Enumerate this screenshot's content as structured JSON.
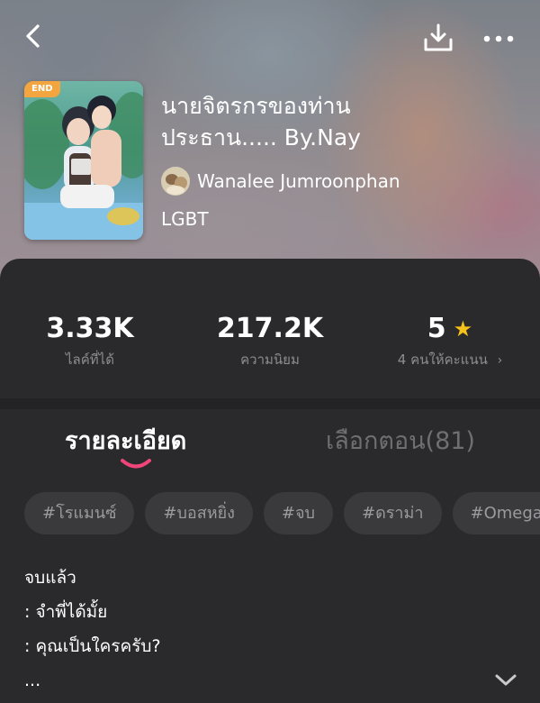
{
  "header": {
    "back_icon": "chevron-left-icon",
    "download_icon": "download-icon",
    "more_icon": "more-horizontal-icon"
  },
  "book": {
    "badge": "END",
    "title": "นายจิตรกรของท่านประธาน..... By.Nay",
    "author": "Wanalee Jumroonphan",
    "genre": "LGBT"
  },
  "stats": {
    "likes": {
      "value": "3.33K",
      "label": "ไลค์ที่ได้"
    },
    "popularity": {
      "value": "217.2K",
      "label": "ความนิยม"
    },
    "rating": {
      "value": "5",
      "label": "4 คนให้คะแนน",
      "star_color": "#f6c21a"
    }
  },
  "tabs": [
    {
      "label": "รายละเอียด",
      "active": true
    },
    {
      "label": "เลือกตอน(81)",
      "active": false
    }
  ],
  "tags": [
    "#โรแมนซ์",
    "#บอสหยิ่ง",
    "#จบ",
    "#ดราม่า",
    "#Omega"
  ],
  "description": {
    "lines": [
      "จบแล้ว",
      ": จำพี่ได้มั้ย",
      ": คุณเป็นใครครับ?",
      "..."
    ]
  },
  "colors": {
    "panel_bg": "#2a2a2c",
    "accent_underline": "#f0457a",
    "badge_bg": "#f3a640",
    "tag_bg": "#3a3a3d"
  }
}
